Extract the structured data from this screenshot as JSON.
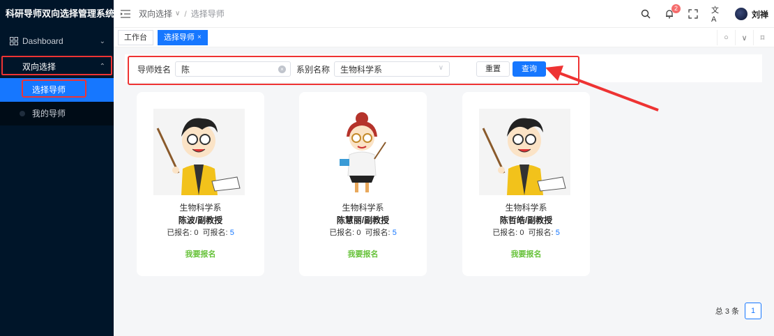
{
  "app": {
    "title": "科研导师双向选择管理系统"
  },
  "sidebar": {
    "dashboard": "Dashboard",
    "group": "双向选择",
    "items": [
      {
        "label": "选择导师"
      },
      {
        "label": "我的导师"
      }
    ]
  },
  "header": {
    "breadcrumb": [
      "双向选择",
      "选择导师"
    ],
    "badge_count": "2",
    "username": "刘禅"
  },
  "tabs": [
    {
      "label": "工作台"
    },
    {
      "label": "选择导师"
    }
  ],
  "search": {
    "teacher_label": "导师姓名",
    "teacher_value": "陈",
    "dept_label": "系别名称",
    "dept_value": "生物科学系",
    "reset_label": "重置",
    "query_label": "查询"
  },
  "cards": [
    {
      "dept": "生物科学系",
      "name": "陈波/副教授",
      "enrolled_label": "已报名:",
      "enrolled": "0",
      "available_label": "可报名:",
      "available": "5",
      "action": "我要报名"
    },
    {
      "dept": "生物科学系",
      "name": "陈慧丽/副教授",
      "enrolled_label": "已报名:",
      "enrolled": "0",
      "available_label": "可报名:",
      "available": "5",
      "action": "我要报名"
    },
    {
      "dept": "生物科学系",
      "name": "陈哲皓/副教授",
      "enrolled_label": "已报名:",
      "enrolled": "0",
      "available_label": "可报名:",
      "available": "5",
      "action": "我要报名"
    }
  ],
  "pager": {
    "total_text": "总 3 条",
    "current_page": "1"
  },
  "colors": {
    "primary": "#1677ff",
    "sidebar": "#001529",
    "success": "#67c23a",
    "annotation": "#e33"
  }
}
